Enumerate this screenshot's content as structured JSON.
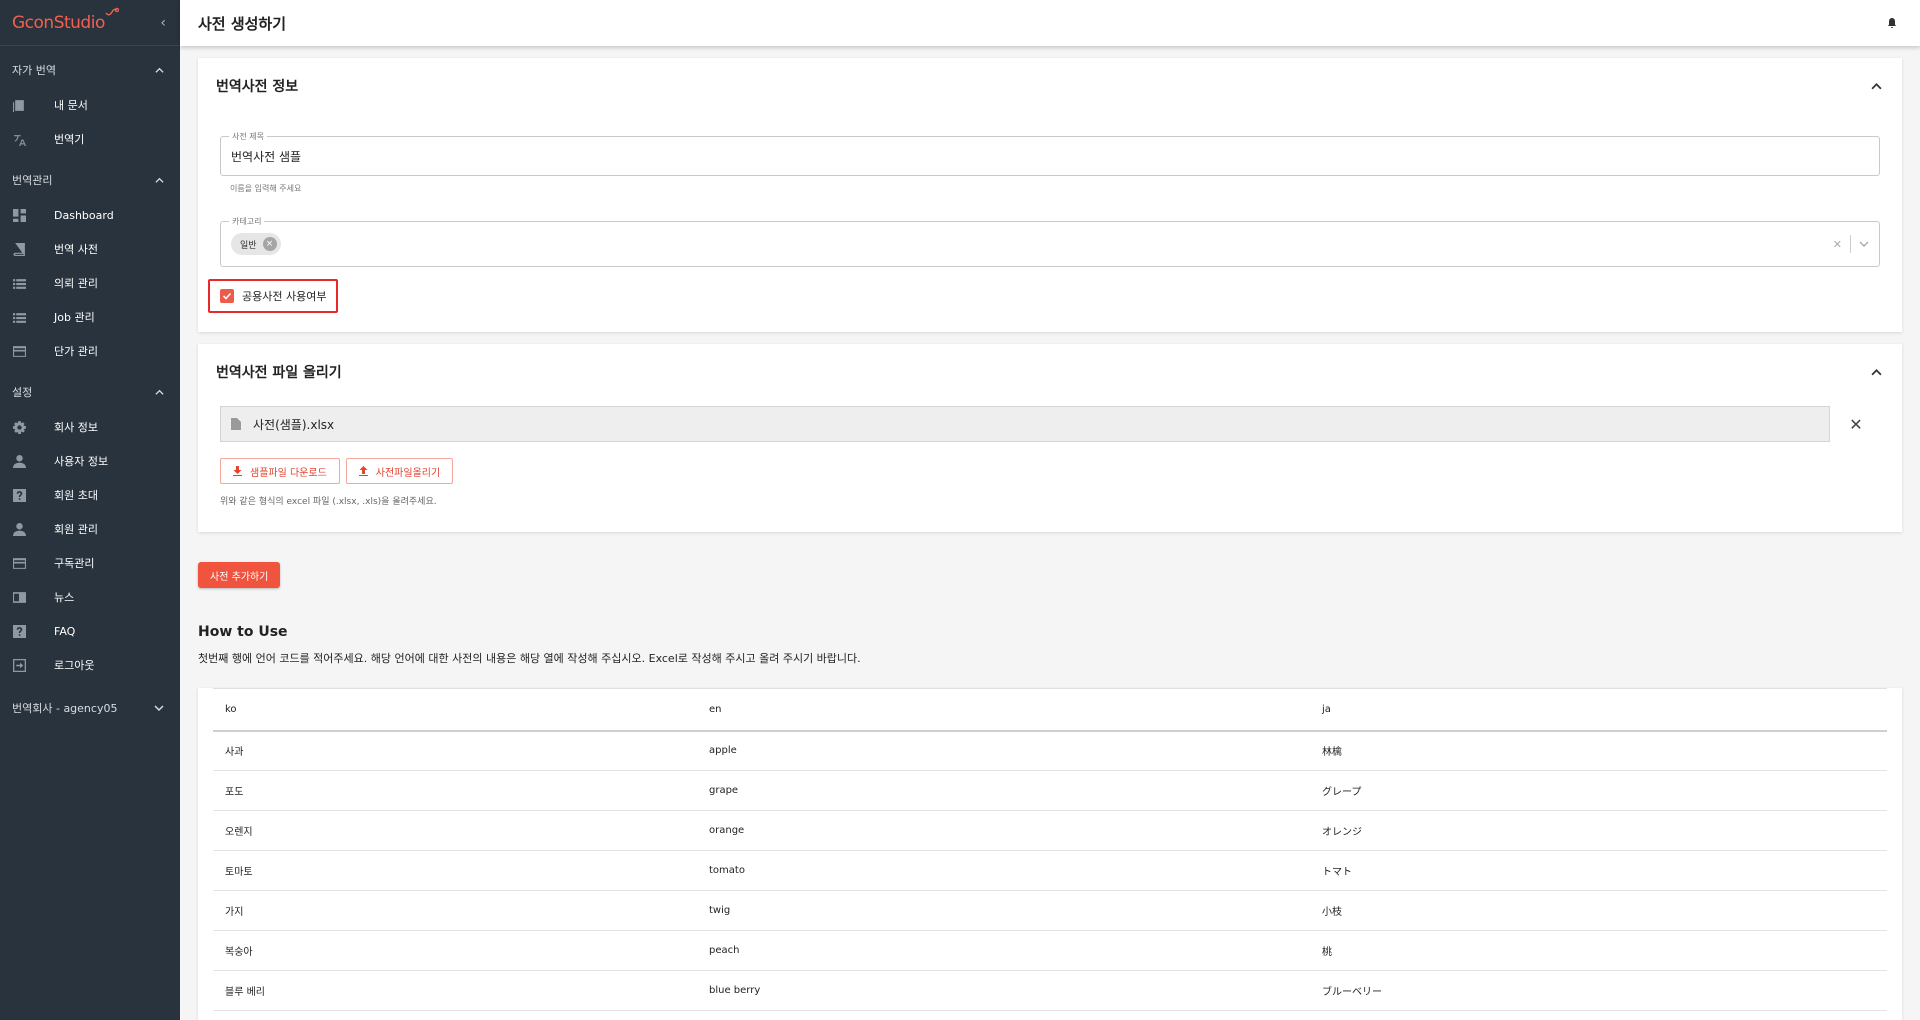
{
  "brand": {
    "logo_text": "GconStudio",
    "accent": "#f0543f"
  },
  "sidebar": {
    "collapse_icon": "chevron-left-icon",
    "sections": [
      {
        "title": "자가 번역",
        "items": [
          {
            "label": "내 문서",
            "icon": "documents-icon"
          },
          {
            "label": "번역기",
            "icon": "translate-icon"
          }
        ]
      },
      {
        "title": "번역관리",
        "items": [
          {
            "label": "Dashboard",
            "icon": "dashboard-icon"
          },
          {
            "label": "번역 사전",
            "icon": "book-icon"
          },
          {
            "label": "의뢰 관리",
            "icon": "list-icon"
          },
          {
            "label": "Job 관리",
            "icon": "list-icon"
          },
          {
            "label": "단가 관리",
            "icon": "card-icon"
          }
        ]
      },
      {
        "title": "설정",
        "items": [
          {
            "label": "회사 정보",
            "icon": "gear-icon"
          },
          {
            "label": "사용자 정보",
            "icon": "person-icon"
          },
          {
            "label": "회원 초대",
            "icon": "help-icon"
          },
          {
            "label": "회원 관리",
            "icon": "person-icon"
          },
          {
            "label": "구독관리",
            "icon": "card-icon"
          },
          {
            "label": "뉴스",
            "icon": "news-icon"
          },
          {
            "label": "FAQ",
            "icon": "help-icon"
          },
          {
            "label": "로그아웃",
            "icon": "logout-icon"
          }
        ]
      }
    ],
    "company": "번역회사 - agency05"
  },
  "header": {
    "title": "사전 생성하기"
  },
  "info_card": {
    "title": "번역사전 정보",
    "name_field": {
      "label": "사전 제목",
      "value": "번역사전 샘플",
      "helper": "이름을 입력해 주세요"
    },
    "category_field": {
      "label": "카테고리",
      "chips": [
        "일반"
      ]
    },
    "public_checkbox": {
      "label": "공용사전 사용여부",
      "checked": true
    }
  },
  "upload_card": {
    "title": "번역사전 파일 올리기",
    "file_name": "사전(샘플).xlsx",
    "download_button": "샘플파일 다운로드",
    "upload_button": "사전파일올리기",
    "note": "위와 같은 형식의 excel 파일 (.xlsx, .xls)을 올려주세요."
  },
  "add_button": "사전 추가하기",
  "howto": {
    "title": "How to Use",
    "description": "첫번째 행에 언어 코드를 적어주세요. 해당 언어에 대한 사전의 내용은 해당 열에 작성해 주십시오. Excel로 작성해 주시고 올려 주시기 바랍니다.",
    "columns": [
      "ko",
      "en",
      "ja"
    ],
    "rows": [
      [
        "사과",
        "apple",
        "林檎"
      ],
      [
        "포도",
        "grape",
        "グレープ"
      ],
      [
        "오렌지",
        "orange",
        "オレンジ"
      ],
      [
        "토마토",
        "tomato",
        "トマト"
      ],
      [
        "가지",
        "twig",
        "小枝"
      ],
      [
        "복숭아",
        "peach",
        "桃"
      ],
      [
        "블루 베리",
        "blue berry",
        "ブルーベリー"
      ]
    ]
  }
}
